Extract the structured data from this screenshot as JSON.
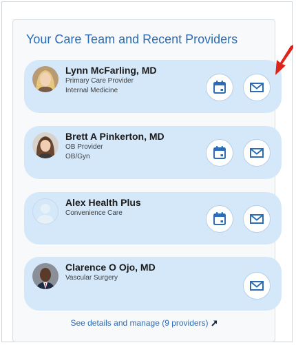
{
  "care_team": {
    "title": "Your Care Team and Recent Providers",
    "providers": [
      {
        "name": "Lynn McFarling, MD",
        "line1": "Primary Care Provider",
        "line2": "Internal Medicine",
        "avatar": "photo",
        "schedule_icon": "calendar-icon",
        "message_icon": "envelope-icon"
      },
      {
        "name": "Brett A Pinkerton, MD",
        "line1": "OB Provider",
        "line2": "OB/Gyn",
        "avatar": "photo",
        "schedule_icon": "calendar-icon",
        "message_icon": "envelope-icon"
      },
      {
        "name": "Alex Health Plus",
        "line1": "Convenience Care",
        "avatar": "placeholder-person-icon",
        "schedule_icon": "calendar-icon",
        "message_icon": "envelope-icon"
      },
      {
        "name": "Clarence O Ojo, MD",
        "line1": "Vascular Surgery",
        "avatar": "photo",
        "message_icon": "envelope-icon"
      }
    ],
    "footer_link": "See details and manage (9 providers)",
    "footer_link_icon": "external-link-icon"
  },
  "colors": {
    "accent": "#2b6cb7",
    "card_bg": "#d4e8fa",
    "annotation_arrow": "#e0231a"
  }
}
